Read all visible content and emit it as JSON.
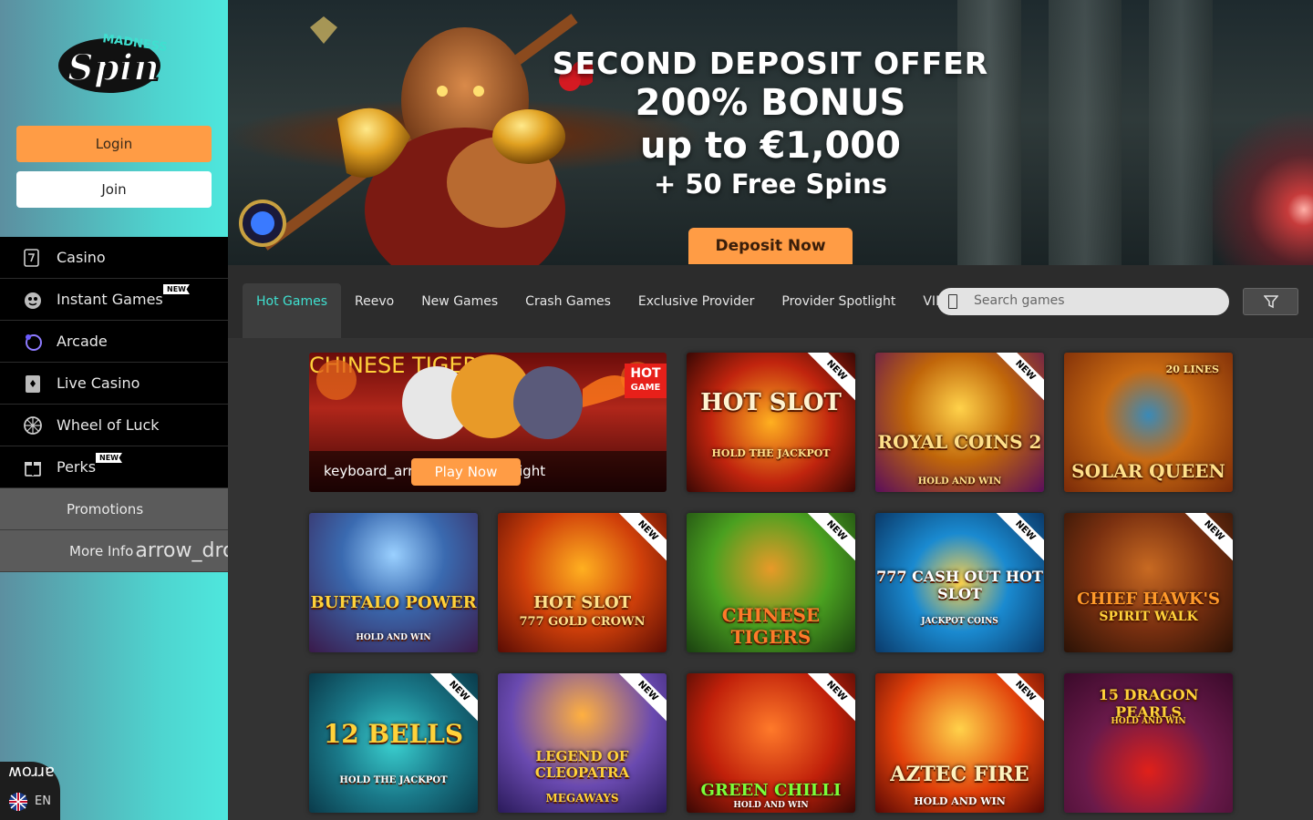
{
  "brand": {
    "logo_text": "Madness Spin"
  },
  "auth": {
    "login_label": "Login",
    "join_label": "Join"
  },
  "menu": {
    "items": [
      {
        "label": "Casino",
        "icon": "casino-icon",
        "badge": ""
      },
      {
        "label": "Instant Games",
        "icon": "instant-games-icon",
        "badge": "NEW"
      },
      {
        "label": "Arcade",
        "icon": "arcade-icon",
        "badge": ""
      },
      {
        "label": "Live Casino",
        "icon": "live-casino-icon",
        "badge": ""
      },
      {
        "label": "Wheel of Luck",
        "icon": "wheel-icon",
        "badge": ""
      },
      {
        "label": "Perks",
        "icon": "gift-icon",
        "badge": "NEW"
      }
    ],
    "sub": [
      {
        "label": "Promotions"
      },
      {
        "label": "More Info",
        "icon_text": "arrow_drop_down"
      }
    ]
  },
  "language": {
    "code": "EN",
    "glyph_text": "arrow"
  },
  "banner": {
    "line1": "SECOND DEPOSIT OFFER",
    "line2": "200% BONUS",
    "line3": "up to €1,000",
    "line4": "+ 50 Free Spins",
    "cta": "Deposit Now"
  },
  "tabs": [
    {
      "label": "Hot Games",
      "active": true
    },
    {
      "label": "Reevo",
      "active": false
    },
    {
      "label": "New Games",
      "active": false
    },
    {
      "label": "Crash Games",
      "active": false
    },
    {
      "label": "Exclusive Provider",
      "active": false
    },
    {
      "label": "Provider Spotlight",
      "active": false
    },
    {
      "label": "VIP",
      "active": false
    }
  ],
  "search": {
    "placeholder": "Search games"
  },
  "featured": {
    "title": "CHINESE TIGERS",
    "hot_badge_line1": "HOT",
    "hot_badge_line2": "GAME",
    "overlay_left": "keyboard_arrow_left",
    "overlay_right": "ight",
    "play_label": "Play Now"
  },
  "games": [
    {
      "title": "HOT SLOT",
      "subtitle": "HOLD THE JACKPOT",
      "new": true
    },
    {
      "title": "ROYAL COINS 2",
      "subtitle": "HOLD AND WIN",
      "new": true
    },
    {
      "title": "SOLAR QUEEN",
      "subtitle": "20 LINES",
      "new": false
    },
    {
      "title": "BUFFALO POWER",
      "subtitle": "HOLD AND WIN",
      "new": false
    },
    {
      "title": "HOT SLOT",
      "subtitle": "777 GOLD CROWN",
      "new": true
    },
    {
      "title": "CHINESE TIGERS",
      "subtitle": "",
      "new": true
    },
    {
      "title": "777 CASH OUT HOT SLOT",
      "subtitle": "JACKPOT COINS",
      "new": true
    },
    {
      "title": "CHIEF HAWK'S",
      "subtitle": "SPIRIT WALK",
      "new": true
    },
    {
      "title": "12 BELLS",
      "subtitle": "HOLD THE JACKPOT",
      "new": true
    },
    {
      "title": "LEGEND OF CLEOPATRA",
      "subtitle": "MEGAWAYS",
      "new": true
    },
    {
      "title": "GREEN CHILLI",
      "subtitle": "HOLD AND WIN",
      "new": true
    },
    {
      "title": "AZTEC FIRE",
      "subtitle": "HOLD AND WIN",
      "new": true
    },
    {
      "title": "15 DRAGON PEARLS",
      "subtitle": "HOLD AND WIN",
      "new": false
    }
  ],
  "colors": {
    "accent": "#ff9c45",
    "tab_active": "#3fe0d0",
    "new_badge": "#ffffff",
    "hot_badge": "#e7201a"
  }
}
